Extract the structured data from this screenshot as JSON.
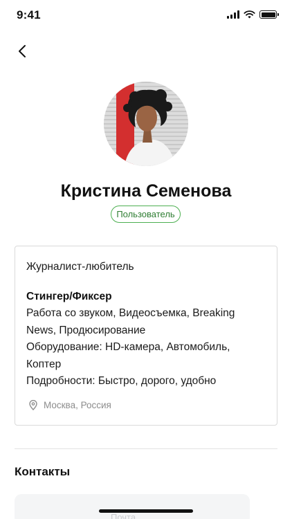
{
  "status_bar": {
    "time": "9:41"
  },
  "profile": {
    "name": "Кристина Семенова",
    "role": "Пользователь"
  },
  "card": {
    "subtitle": "Журналист-любитель",
    "title": "Стингер/Фиксер",
    "lines": [
      "Работа со звуком, Видеосъемка, Breaking",
      "News, Продюсирование",
      "Оборудование: HD-камера, Автомобиль,",
      "Коптер",
      "Подробности: Быстро, дорого, удобно"
    ],
    "location": "Москва, Россия"
  },
  "contacts": {
    "title": "Контакты",
    "partial_label": "Почта"
  },
  "icons": {
    "back": "chevron-left-icon",
    "location": "map-pin-icon"
  },
  "colors": {
    "badge_border": "#4caf50",
    "badge_text": "#2e7d32",
    "muted_text": "#8c8c8c"
  }
}
